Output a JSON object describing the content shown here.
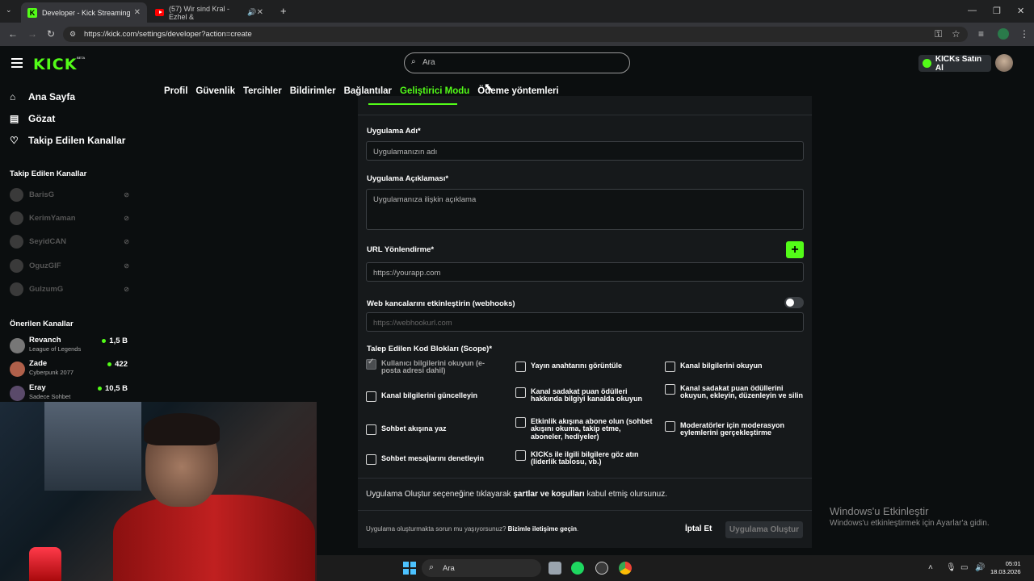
{
  "browser": {
    "tabs": [
      {
        "title": "Developer - Kick Streaming",
        "close": "✕"
      },
      {
        "title": "(57) Wir sind Kral - Ezhel &",
        "close": "✕"
      }
    ],
    "url": "https://kick.com/settings/developer?action=create",
    "new_tab": "+"
  },
  "header": {
    "logo": "KICK",
    "logo_badge": "BETA",
    "search_placeholder": "Ara",
    "kicks_button": "KICKs Satın Al"
  },
  "sidebar": {
    "main_nav": [
      {
        "label": "Ana Sayfa",
        "icon": "home-icon"
      },
      {
        "label": "Gözat",
        "icon": "browse-icon"
      },
      {
        "label": "Takip Edilen Kanallar",
        "icon": "heart-icon"
      }
    ],
    "followed_title": "Takip Edilen Kanallar",
    "followed": [
      {
        "name": "BarisG"
      },
      {
        "name": "KerimYaman"
      },
      {
        "name": "SeyidCAN"
      },
      {
        "name": "OguzGIF"
      },
      {
        "name": "GulzumG"
      }
    ],
    "recommended_title": "Önerilen Kanallar",
    "recommended": [
      {
        "name": "Revanch",
        "category": "League of Legends",
        "viewers": "1,5 B"
      },
      {
        "name": "Zade",
        "category": "Cyberpunk 2077",
        "viewers": "422"
      },
      {
        "name": "Eray",
        "category": "Sadece Sohbet",
        "viewers": "10,5 B"
      }
    ]
  },
  "settings_tabs": [
    {
      "label": "Profil",
      "active": false
    },
    {
      "label": "Güvenlik",
      "active": false
    },
    {
      "label": "Tercihler",
      "active": false
    },
    {
      "label": "Bildirimler",
      "active": false
    },
    {
      "label": "Bağlantılar",
      "active": false
    },
    {
      "label": "Geliştirici Modu",
      "active": true
    },
    {
      "label": "Ödeme yöntemleri",
      "active": false
    }
  ],
  "form": {
    "app_name_label": "Uygulama Adı*",
    "app_name_placeholder": "Uygulamanızın adı",
    "app_desc_label": "Uygulama Açıklaması*",
    "app_desc_placeholder": "Uygulamanıza ilişkin açıklama",
    "redirect_label": "URL Yönlendirme*",
    "redirect_placeholder": "https://yourapp.com",
    "add_button": "+",
    "webhooks_label": "Web kancalarını etkinleştirin (webhooks)",
    "webhooks_enabled": false,
    "webhook_placeholder": "https://webhookurl.com",
    "scopes_label": "Talep Edilen Kod Blokları (Scope)*",
    "scopes": [
      {
        "label": "Kullanıcı bilgilerini okuyun (e-posta adresi dahil)",
        "checked": true
      },
      {
        "label": "Yayın anahtarını görüntüle",
        "checked": false
      },
      {
        "label": "Kanal bilgilerini okuyun",
        "checked": false
      },
      {
        "label": "Kanal bilgilerini güncelleyin",
        "checked": false
      },
      {
        "label": "Kanal sadakat puan ödülleri hakkında bilgiyi kanalda okuyun",
        "checked": false
      },
      {
        "label": "Kanal sadakat puan ödüllerini okuyun, ekleyin, düzenleyin ve silin",
        "checked": false
      },
      {
        "label": "Sohbet akışına yaz",
        "checked": false
      },
      {
        "label": "Etkinlik akışına abone olun (sohbet akışını okuma, takip etme, aboneler, hediyeler)",
        "checked": false
      },
      {
        "label": "Moderatörler için moderasyon eylemlerini gerçekleştirme",
        "checked": false
      },
      {
        "label": "Sohbet mesajlarını denetleyin",
        "checked": false
      },
      {
        "label": "KICKs ile ilgili bilgilere göz atın (liderlik tablosu, vb.)",
        "checked": false
      }
    ],
    "terms_prefix": "Uygulama Oluştur seçeneğine tıklayarak ",
    "terms_link": "şartlar ve koşulları",
    "terms_suffix": " kabul etmiş olursunuz.",
    "footer_text": "Uygulama oluşturmakta sorun mu yaşıyorsunuz? ",
    "footer_link": "Bizimle iletişime geçin",
    "footer_end": ".",
    "cancel_button": "İptal Et",
    "create_button": "Uygulama Oluştur"
  },
  "watermark": {
    "title": "Windows'u Etkinleştir",
    "subtitle": "Windows'u etkinleştirmek için Ayarlar'a gidin."
  },
  "taskbar": {
    "search_placeholder": "Ara",
    "time": "05:01",
    "date": "18.03.2026"
  },
  "colors": {
    "accent": "#53fc18",
    "panel": "#16191b",
    "background": "#0b0e0f"
  }
}
